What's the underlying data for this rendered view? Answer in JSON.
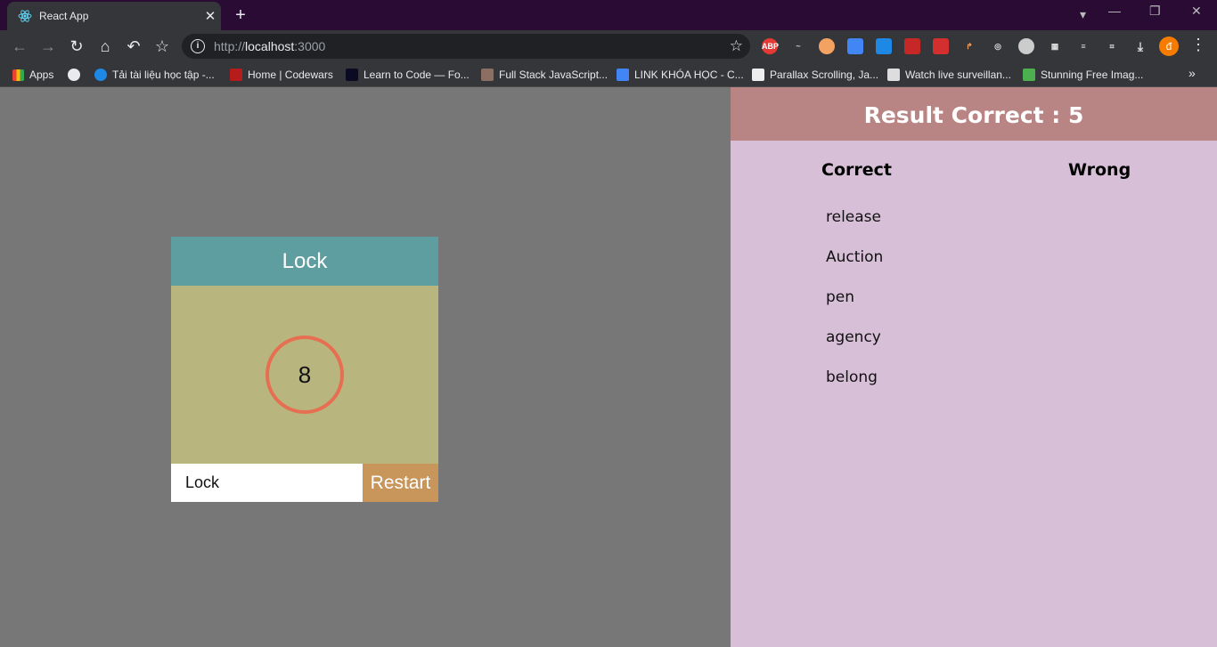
{
  "browser": {
    "tab_title": "React App",
    "url_prefix": "http://",
    "url_host": "localhost",
    "url_port": ":3000",
    "bookmarks": [
      "Apps",
      "Tải tài liệu học tập -...",
      "Home | Codewars",
      "Learn to Code — Fo...",
      "Full Stack JavaScript...",
      "LINK KHÓA HỌC - C...",
      "Parallax Scrolling, Ja...",
      "Watch live surveillan...",
      "Stunning Free Imag..."
    ],
    "extensions": [
      "ABP"
    ],
    "avatar_letter": "đ"
  },
  "game": {
    "word": "Lock",
    "timer": "8",
    "input_value": "Lock",
    "restart_label": "Restart"
  },
  "result": {
    "title": "Result Correct : 5",
    "correct_label": "Correct",
    "wrong_label": "Wrong",
    "correct_words": [
      "release",
      "Auction",
      "pen",
      "agency",
      "belong"
    ],
    "wrong_words": []
  },
  "colors": {
    "word_header": "#5f9ea0",
    "card_body": "#b8b57f",
    "timer_ring": "#e76f51",
    "restart_button": "#c8965a",
    "result_header": "#b88484",
    "result_panel": "#d8bfd8"
  }
}
